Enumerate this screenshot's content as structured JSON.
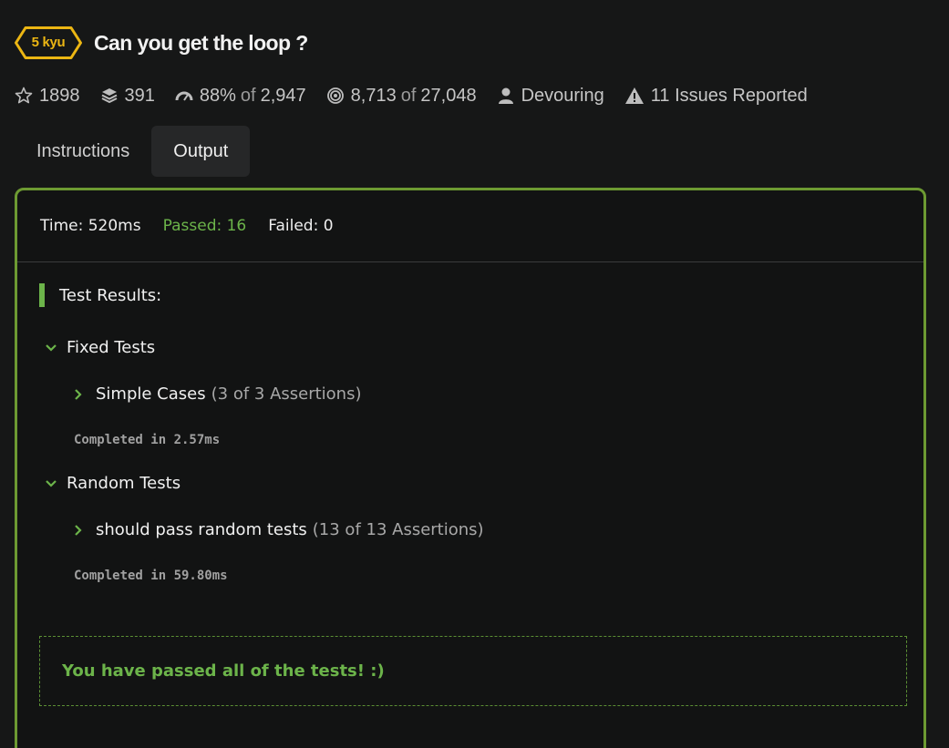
{
  "kata": {
    "rank": "5 kyu",
    "title": "Can you get the loop ?"
  },
  "stats": {
    "stars": "1898",
    "collections": "391",
    "satisfaction_percent": "88%",
    "satisfaction_of": "of",
    "satisfaction_votes": "2,947",
    "completed": "8,713",
    "completed_of": "of",
    "attempts": "27,048",
    "author": "Devouring",
    "issues": "11 Issues Reported"
  },
  "tabs": {
    "instructions": "Instructions",
    "output": "Output"
  },
  "summary": {
    "time": "Time: 520ms",
    "passed": "Passed: 16",
    "failed": "Failed: 0"
  },
  "results": {
    "heading": "Test Results:",
    "groups": [
      {
        "name": "Fixed Tests",
        "case": "Simple Cases",
        "assertions": "(3 of 3 Assertions)",
        "completed": "Completed in 2.57ms"
      },
      {
        "name": "Random Tests",
        "case": "should pass random tests",
        "assertions": "(13 of 13 Assertions)",
        "completed": "Completed in 59.80ms"
      }
    ],
    "passed_message": "You have passed all of the tests! :)"
  },
  "colors": {
    "rank_yellow": "#ecb613",
    "success_green": "#6cb44a",
    "panel_border": "#6d9a32",
    "background": "#161717"
  },
  "icons": {
    "stars": "star-icon",
    "collections": "layers-icon",
    "satisfaction": "gauge-icon",
    "completed": "target-icon",
    "author": "user-icon",
    "issues": "warning-icon",
    "expand": "chevron-down-icon",
    "collapse": "chevron-right-icon"
  }
}
